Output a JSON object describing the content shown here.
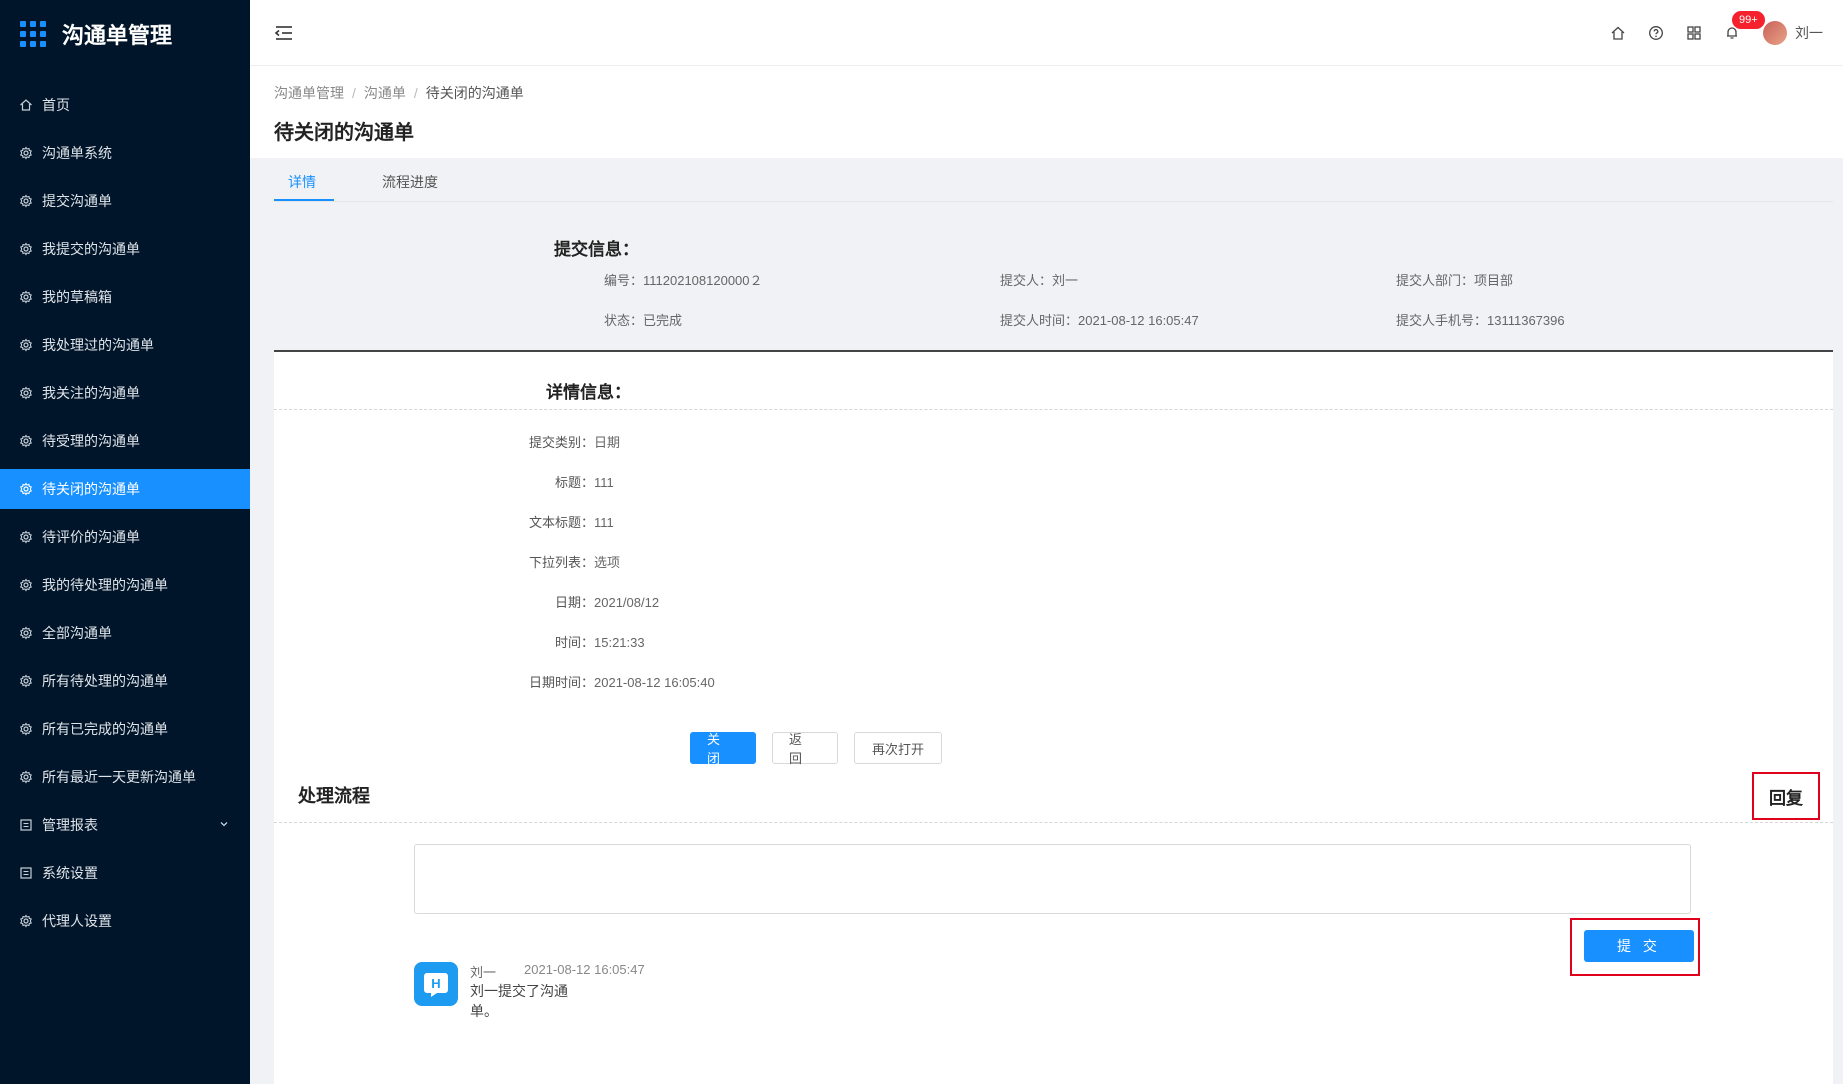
{
  "app": {
    "title": "沟通单管理"
  },
  "sidebar": {
    "items": [
      {
        "label": "首页",
        "icon": "home-icon"
      },
      {
        "label": "沟通单系统",
        "icon": "gear-icon"
      },
      {
        "label": "提交沟通单",
        "icon": "gear-icon"
      },
      {
        "label": "我提交的沟通单",
        "icon": "gear-icon"
      },
      {
        "label": "我的草稿箱",
        "icon": "gear-icon"
      },
      {
        "label": "我处理过的沟通单",
        "icon": "gear-icon"
      },
      {
        "label": "我关注的沟通单",
        "icon": "gear-icon"
      },
      {
        "label": "待受理的沟通单",
        "icon": "gear-icon"
      },
      {
        "label": "待关闭的沟通单",
        "icon": "gear-icon",
        "active": true
      },
      {
        "label": "待评价的沟通单",
        "icon": "gear-icon"
      },
      {
        "label": "我的待处理的沟通单",
        "icon": "gear-icon"
      },
      {
        "label": "全部沟通单",
        "icon": "gear-icon"
      },
      {
        "label": "所有待处理的沟通单",
        "icon": "gear-icon"
      },
      {
        "label": "所有已完成的沟通单",
        "icon": "gear-icon"
      },
      {
        "label": "所有最近一天更新沟通单",
        "icon": "gear-icon"
      },
      {
        "label": "管理报表",
        "icon": "report-icon",
        "has_caret": true
      },
      {
        "label": "系统设置",
        "icon": "report-icon"
      },
      {
        "label": "代理人设置",
        "icon": "gear-icon"
      }
    ]
  },
  "header": {
    "notification_badge": "99+",
    "user_name": "刘一"
  },
  "breadcrumb": [
    "沟通单管理",
    "沟通单",
    "待关闭的沟通单"
  ],
  "page_title": "待关闭的沟通单",
  "tabs": [
    {
      "label": "详情",
      "active": true
    },
    {
      "label": "流程进度"
    }
  ],
  "submit_info": {
    "title": "提交信息：",
    "number": "编号：111202108120000２",
    "submitter": "提交人：刘一",
    "department": "提交人部门：项目部",
    "status": "状态：已完成",
    "submit_time": "提交人时间：2021-08-12 16:05:47",
    "phone": "提交人手机号：13111367396"
  },
  "detail_info": {
    "title": "详情信息：",
    "rows": [
      {
        "label": "提交类别：",
        "value": "日期"
      },
      {
        "label": "标题：",
        "value": "111"
      },
      {
        "label": "文本标题：",
        "value": "111"
      },
      {
        "label": "下拉列表：",
        "value": "选项"
      },
      {
        "label": "日期：",
        "value": "2021/08/12"
      },
      {
        "label": "时间：",
        "value": "15:21:33"
      },
      {
        "label": "日期时间：",
        "value": "2021-08-12 16:05:40"
      }
    ]
  },
  "actions": {
    "close": "关 闭",
    "back": "返 回",
    "reopen": "再次打开"
  },
  "process": {
    "title": "处理流程",
    "reply_label": "回复",
    "reply_placeholder": "",
    "submit_label": "提 交",
    "log": {
      "name": "刘一",
      "time": "2021-08-12 16:05:47",
      "text": "刘一提交了沟通单。"
    }
  },
  "colors": {
    "sidebar_bg": "#001529",
    "primary": "#1890ff",
    "highlight_border": "#e0001b"
  }
}
